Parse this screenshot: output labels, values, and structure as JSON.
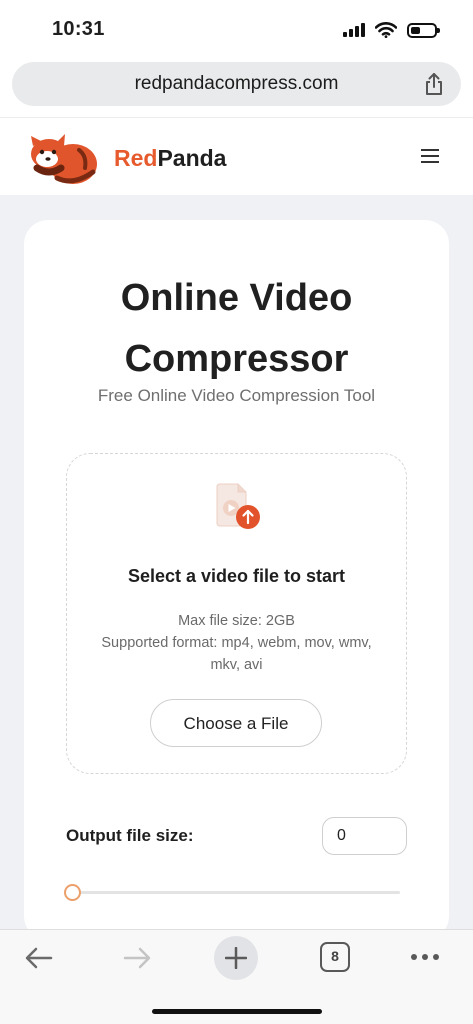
{
  "status_bar": {
    "time": "10:31",
    "icons": [
      "cellular-signal-icon",
      "wifi-icon",
      "battery-icon"
    ],
    "battery_level": 0.4
  },
  "browser": {
    "url": "redpandacompress.com",
    "share_icon": "share-icon",
    "toolbar": {
      "back_icon": "arrow-left-icon",
      "forward_icon": "arrow-right-icon",
      "new_tab_icon": "plus-icon",
      "tab_count": "8",
      "more_icon": "ellipsis-icon"
    }
  },
  "site_header": {
    "brand_red": "Red",
    "brand_dark": "Panda",
    "menu_icon": "hamburger-menu-icon"
  },
  "main": {
    "title_line1": "Online Video",
    "title_line2": "Compressor",
    "subtitle": "Free Online Video Compression Tool",
    "dropzone": {
      "icon": "video-upload-icon",
      "title": "Select a video file to start",
      "max_size": "Max file size: 2GB",
      "formats": "Supported format: mp4, webm, mov, wmv, mkv, avi",
      "button_label": "Choose a File"
    },
    "output": {
      "label": "Output file size:",
      "value": "0",
      "slider_level": 0
    }
  },
  "colors": {
    "brand": "#e65a2e",
    "page_background": "#eff1f5",
    "slider_thumb": "#eba06b",
    "upload_badge": "#e2532b"
  }
}
